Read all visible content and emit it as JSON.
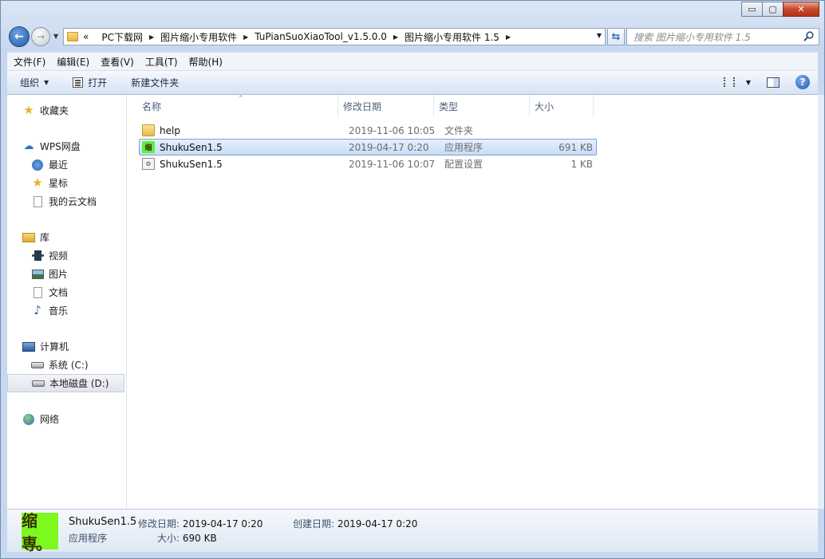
{
  "caption": {
    "minimize": "▭",
    "maximize": "▢",
    "close": "✕"
  },
  "address": {
    "prefix": "«",
    "crumbs": [
      "PC下载网",
      "图片缩小专用软件",
      "TuPianSuoXiaoTool_v1.5.0.0",
      "图片缩小专用软件 1.5"
    ],
    "search_placeholder": "搜索 图片缩小专用软件 1.5"
  },
  "menu": [
    "文件(F)",
    "编辑(E)",
    "查看(V)",
    "工具(T)",
    "帮助(H)"
  ],
  "toolbar": {
    "organize": "组织",
    "open": "打开",
    "new_folder": "新建文件夹"
  },
  "nav": {
    "favorites": "收藏夹",
    "wps": {
      "label": "WPS网盘",
      "items": [
        "最近",
        "星标",
        "我的云文档"
      ]
    },
    "library": {
      "label": "库",
      "items": [
        "视频",
        "图片",
        "文档",
        "音乐"
      ]
    },
    "computer": {
      "label": "计算机",
      "items": [
        "系统 (C:)",
        "本地磁盘 (D:)"
      ]
    },
    "network": "网络"
  },
  "columns": {
    "name": "名称",
    "date": "修改日期",
    "type": "类型",
    "size": "大小"
  },
  "files": [
    {
      "name": "help",
      "date": "2019-11-06 10:05",
      "type": "文件夹",
      "size": ""
    },
    {
      "name": "ShukuSen1.5",
      "date": "2019-04-17 0:20",
      "type": "应用程序",
      "size": "691 KB"
    },
    {
      "name": "ShukuSen1.5",
      "date": "2019-11-06 10:07",
      "type": "配置设置",
      "size": "1 KB"
    }
  ],
  "details": {
    "name": "ShukuSen1.5",
    "type": "应用程序",
    "modified_label": "修改日期:",
    "modified_value": "2019-04-17 0:20",
    "size_label": "大小:",
    "size_value": "690 KB",
    "created_label": "创建日期:",
    "created_value": "2019-04-17 0:20",
    "icon_text": "缩専。"
  },
  "app_icon_text": "缩"
}
